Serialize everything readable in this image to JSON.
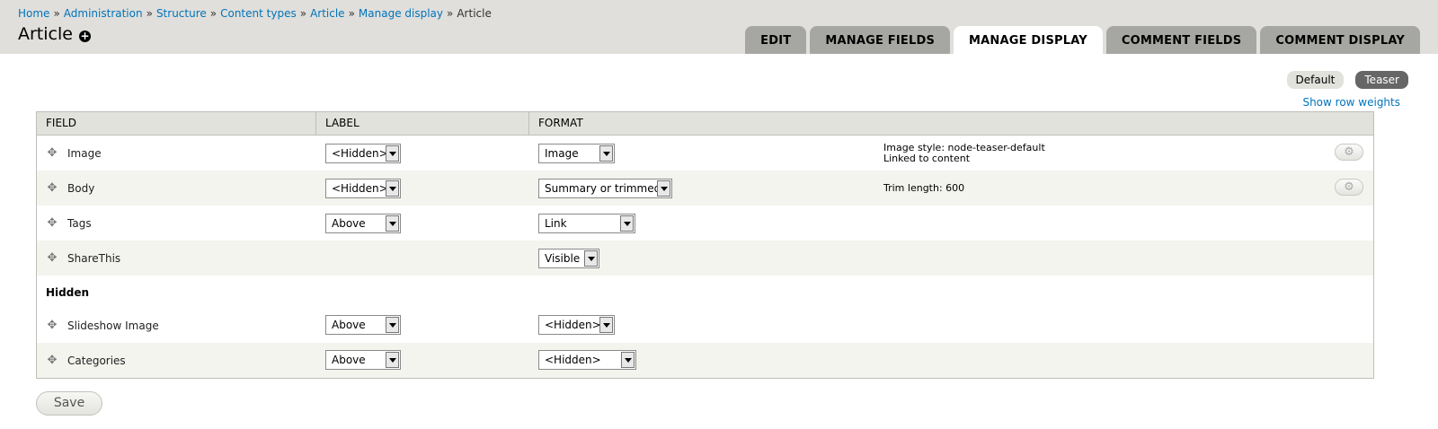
{
  "breadcrumb": {
    "items": [
      "Home",
      "Administration",
      "Structure",
      "Content types",
      "Article",
      "Manage display"
    ],
    "current": "Article",
    "separator": "»"
  },
  "page": {
    "title": "Article"
  },
  "tabs": [
    "EDIT",
    "MANAGE FIELDS",
    "MANAGE DISPLAY",
    "COMMENT FIELDS",
    "COMMENT DISPLAY"
  ],
  "active_tab": "MANAGE DISPLAY",
  "view_modes": [
    "Default",
    "Teaser"
  ],
  "active_view_mode": "Teaser",
  "row_weights_link": "Show row weights",
  "table": {
    "headers": {
      "field": "FIELD",
      "label": "LABEL",
      "format": "FORMAT"
    },
    "rows": [
      {
        "field": "Image",
        "label": "<Hidden>",
        "format": "Image",
        "summary": [
          "Image style: node-teaser-default",
          "Linked to content"
        ],
        "settings": true
      },
      {
        "field": "Body",
        "label": "<Hidden>",
        "format": "Summary or trimmed",
        "summary": [
          "Trim length: 600"
        ],
        "settings": true
      },
      {
        "field": "Tags",
        "label": "Above",
        "format": "Link",
        "summary": [],
        "settings": false
      },
      {
        "field": "ShareThis",
        "label": "",
        "format": "Visible",
        "summary": [],
        "settings": false
      }
    ],
    "hidden_region_title": "Hidden",
    "hidden_rows": [
      {
        "field": "Slideshow Image",
        "label": "Above",
        "format": "<Hidden>"
      },
      {
        "field": "Categories",
        "label": "Above",
        "format": "<Hidden>"
      }
    ]
  },
  "save_button": "Save",
  "colors": {
    "link": "#0074bd",
    "tab_inactive": "#a6a7a2",
    "header_bg": "#e0dfdb"
  }
}
